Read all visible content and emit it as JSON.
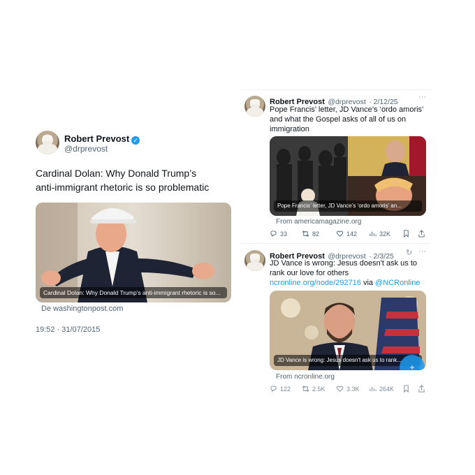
{
  "left_tweet": {
    "name": "Robert Prevost",
    "handle": "@drprevost",
    "verified_icon": "verified-badge-icon",
    "text": "Cardinal Dolan: Why Donald Trump’s anti-immigrant rhetoric is so problematic",
    "card_caption": "Cardinal Dolan: Why Donald Trump’s anti-immigrant rhetoric is so...",
    "source": "De washingtonpost.com",
    "timestamp": "19:52 · 31/07/2015"
  },
  "right_tweets": [
    {
      "name": "Robert Prevost",
      "handle": "@drprevost",
      "date": "· 2/12/25",
      "text": "Pope Francis’ letter, JD Vance’s ‘ordo amoris’ and what the Gospel asks of all of us on immigration",
      "card_caption": "Pope Francis’ letter, JD Vance’s ‘ordo amoris’ an...",
      "source": "From americamagazine.org",
      "stats": {
        "replies": "33",
        "reposts": "82",
        "likes": "142",
        "views": "32K"
      }
    },
    {
      "name": "Robert Prevost",
      "handle": "@drprevost",
      "date": "· 2/3/25",
      "text_start": "JD Vance is wrong: Jesus doesn't ask us to rank our love for others ",
      "link_text": "ncronline.org/node/292716",
      "via_text": " via ",
      "mention_text": "@NCRonline",
      "card_caption": "JD Vance is wrong: Jesus doesn't ask us to rank...",
      "source": "From ncronline.org",
      "stats": {
        "replies": "122",
        "reposts": "2.5K",
        "likes": "3.3K",
        "views": "264K"
      }
    }
  ],
  "colors": {
    "accent": "#1d9bf0",
    "muted": "#536471",
    "text": "#0f1419"
  }
}
